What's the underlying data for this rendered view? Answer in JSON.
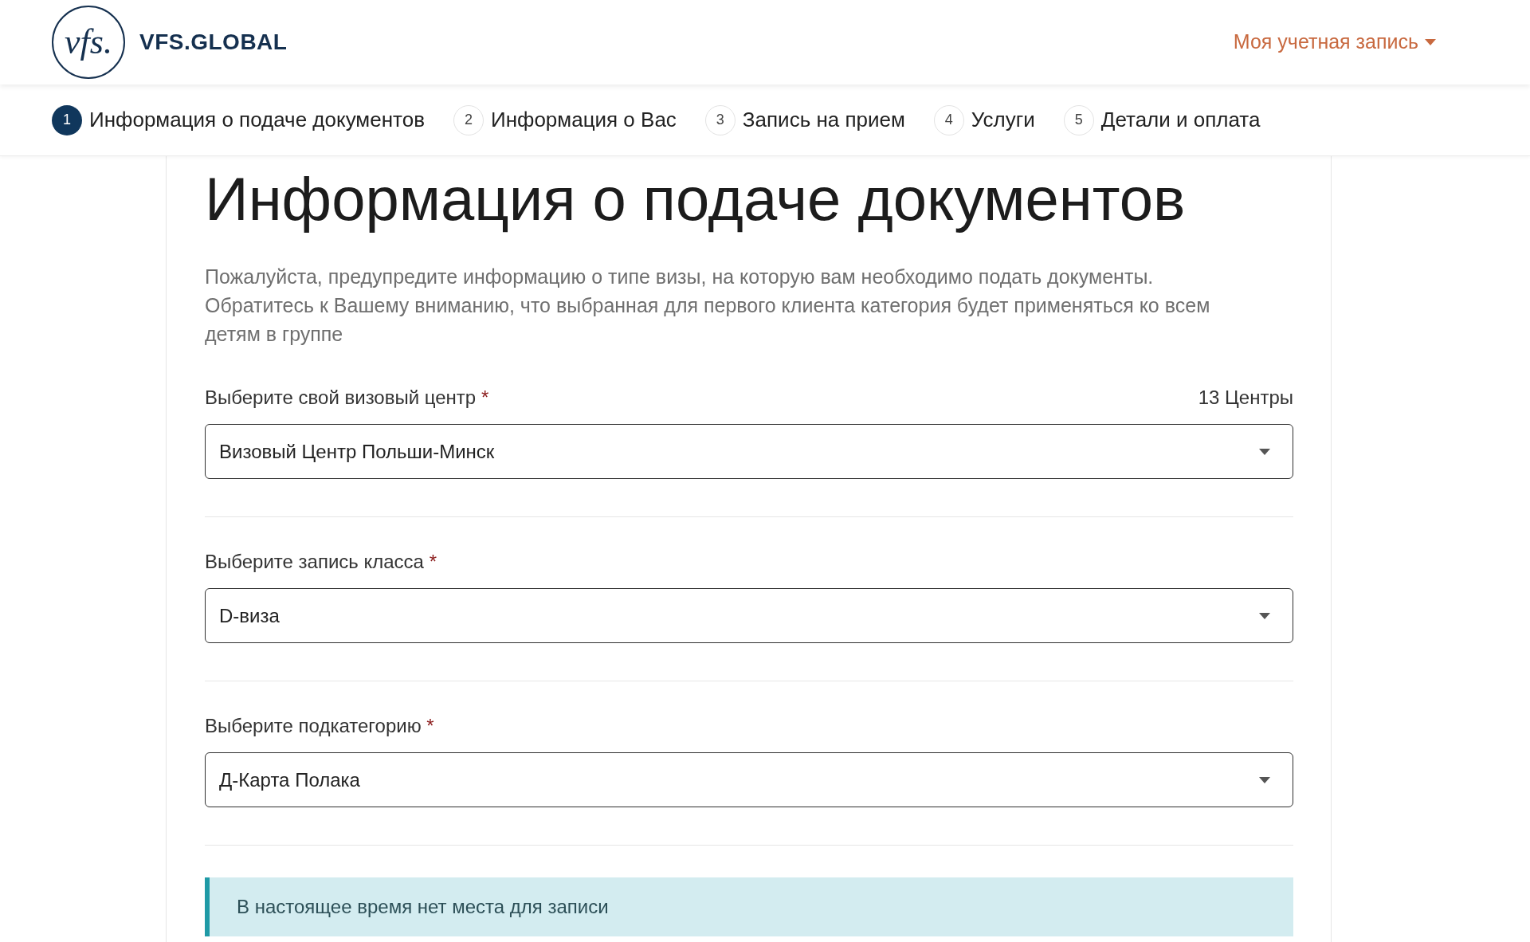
{
  "header": {
    "logo_mark": "vfs.",
    "logo_text": "VFS.GLOBAL",
    "account_menu": "Моя учетная запись"
  },
  "steps": [
    {
      "number": "1",
      "label": "Информация о подаче документов",
      "selected": true
    },
    {
      "number": "2",
      "label": "Информация о Вас",
      "selected": false
    },
    {
      "number": "3",
      "label": "Запись на прием",
      "selected": false
    },
    {
      "number": "4",
      "label": "Услуги",
      "selected": false
    },
    {
      "number": "5",
      "label": "Детали и оплата",
      "selected": false
    }
  ],
  "page": {
    "title": "Информация о подаче документов",
    "description": "Пожалуйста, предупредите информацию о типе визы, на которую вам необходимо подать документы. Обратитесь к Вашему вниманию, что выбранная для первого клиента категория будет применяться ко всем детям в группе"
  },
  "fields": [
    {
      "label": "Выберите свой визовый центр",
      "required_mark": "*",
      "count": "13 Центры",
      "value": "Визовый Центр Польши-Минск"
    },
    {
      "label": "Выберите запись класса",
      "required_mark": "*",
      "value": "D-виза"
    },
    {
      "label": "Выберите подкатегорию",
      "required_mark": "*",
      "value": "Д-Карта Полака"
    }
  ],
  "alert": {
    "message": "В настоящее время нет места для записи"
  }
}
